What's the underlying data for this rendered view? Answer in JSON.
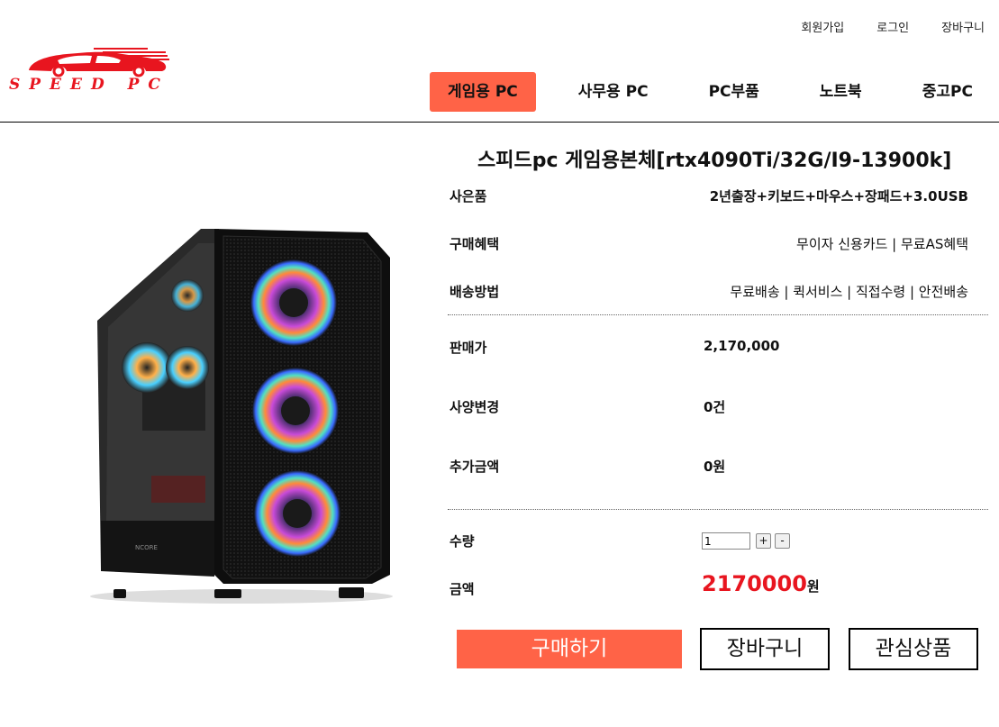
{
  "header": {
    "links": [
      "회원가입",
      "로그인",
      "장바구니"
    ],
    "logo_text": "SPEED PC",
    "brand_color": "#e8151f",
    "accent_color": "#ff6347",
    "nav": [
      "게임용 PC",
      "사무용 PC",
      "PC부품",
      "노트북",
      "중고PC"
    ],
    "active_nav": "게임용 PC"
  },
  "product": {
    "title": "스피드pc 게임용본체[rtx4090Ti/32G/I9-13900k]",
    "image_brand": "NCORE",
    "details": [
      {
        "label": "사은품",
        "value": "2년출장+키보드+마우스+장패드+3.0USB"
      },
      {
        "label": "구매혜택",
        "value": "무이자 신용카드 | 무료AS혜택"
      },
      {
        "label": "배송방법",
        "value": "무료배송 | 퀵서비스 | 직접수령 | 안전배송"
      }
    ],
    "pricing": [
      {
        "label": "판매가",
        "value": "2,170,000"
      },
      {
        "label": "사양변경",
        "value": "0건"
      },
      {
        "label": "추가금액",
        "value": "0원"
      }
    ],
    "quantity_label": "수량",
    "quantity": "1",
    "plus": "+",
    "minus": "-",
    "total_label": "금액",
    "total_value": "2170000",
    "total_unit": "원"
  },
  "actions": {
    "buy": "구매하기",
    "cart": "장바구니",
    "wishlist": "관심상품"
  }
}
